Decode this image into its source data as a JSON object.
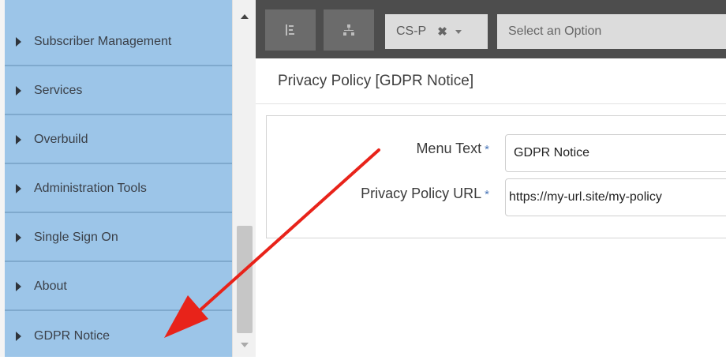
{
  "sidebar": {
    "items": [
      {
        "label": "Subscriber Management"
      },
      {
        "label": "Services"
      },
      {
        "label": "Overbuild"
      },
      {
        "label": "Administration Tools"
      },
      {
        "label": "Single Sign On"
      },
      {
        "label": "About"
      },
      {
        "label": "GDPR Notice"
      }
    ]
  },
  "toolbar": {
    "list_icon": "list-tree-icon",
    "org_icon": "hierarchy-icon",
    "chip_value": "CS-P",
    "chip_remove": "✖",
    "select_placeholder": "Select an Option"
  },
  "main": {
    "title": "Privacy Policy [GDPR Notice]",
    "required_mark": "*",
    "fields": [
      {
        "label": "Menu Text",
        "value": "GDPR Notice"
      },
      {
        "label": "Privacy Policy URL",
        "value": "https://my-url.site/my-policy"
      }
    ]
  },
  "colors": {
    "sidebar_bg": "#9cc5e8",
    "toolbar_bg": "#4d4d4d",
    "annotation_arrow": "#e8231a"
  }
}
